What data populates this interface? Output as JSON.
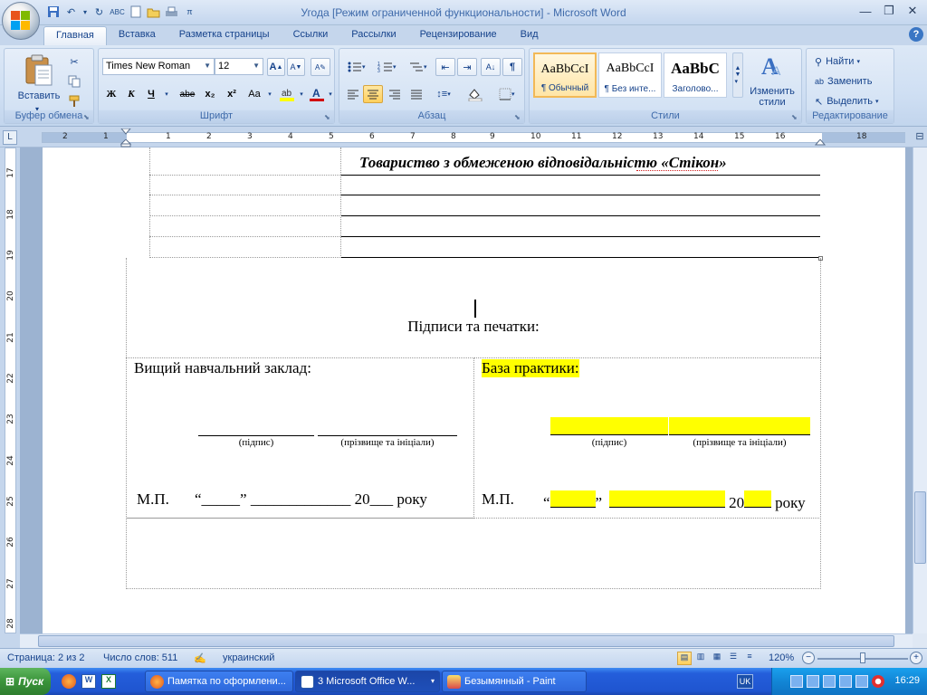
{
  "window": {
    "title": "Угода [Режим ограниченной функциональности] - Microsoft Word"
  },
  "tabs": [
    "Главная",
    "Вставка",
    "Разметка страницы",
    "Ссылки",
    "Рассылки",
    "Рецензирование",
    "Вид"
  ],
  "ribbon": {
    "clipboard": {
      "label": "Буфер обмена",
      "paste": "Вставить"
    },
    "font": {
      "label": "Шрифт",
      "name": "Times New Roman",
      "size": "12",
      "bold": "Ж",
      "italic": "К",
      "underline": "Ч",
      "strike": "abe",
      "sub": "x₂",
      "sup": "x²",
      "case": "Aa"
    },
    "paragraph": {
      "label": "Абзац"
    },
    "styles": {
      "label": "Стили",
      "items": [
        {
          "sample": "AaBbCcI",
          "name": "¶ Обычный"
        },
        {
          "sample": "AaBbCcI",
          "name": "¶ Без инте..."
        },
        {
          "sample": "AaBbC",
          "name": "Заголово..."
        }
      ],
      "change": "Изменить стили"
    },
    "editing": {
      "label": "Редактирование",
      "find": "Найти",
      "replace": "Заменить",
      "select": "Выделить"
    }
  },
  "ruler": {
    "h_numbers": [
      "2",
      "1",
      "1",
      "2",
      "3",
      "4",
      "5",
      "6",
      "7",
      "8",
      "9",
      "10",
      "11",
      "12",
      "13",
      "14",
      "15",
      "16",
      "18"
    ],
    "v_numbers": [
      "17",
      "18",
      "19",
      "20",
      "21",
      "22",
      "23",
      "24",
      "25",
      "26",
      "27",
      "28"
    ]
  },
  "document": {
    "company": "Товариство з обмеженою відповідальністю «Стікон»",
    "signatures_title": "Підписи та печатки:",
    "left": {
      "heading": "Вищий навчальний заклад:",
      "sign_label": "(підпис)",
      "name_label": "(прізвище та ініціали)",
      "mp": "М.П.",
      "date_line": "“_____” _____________ 20___ року"
    },
    "right": {
      "heading": "База практики:",
      "sign_label": "(підпис)",
      "name_label": "(прізвище та ініціали)",
      "mp": "М.П.",
      "quote_open": "“",
      "quote_close": "”",
      "year_prefix": "20",
      "year_suffix": "року"
    }
  },
  "statusbar": {
    "page": "Страница: 2 из 2",
    "words": "Число слов: 511",
    "language": "украинский",
    "zoom": "120%"
  },
  "taskbar": {
    "start": "Пуск",
    "tasks": [
      "Памятка по оформлени...",
      "3 Microsoft Office W...",
      "Безымянный - Paint"
    ],
    "lang": "UK",
    "time": "16:29"
  }
}
